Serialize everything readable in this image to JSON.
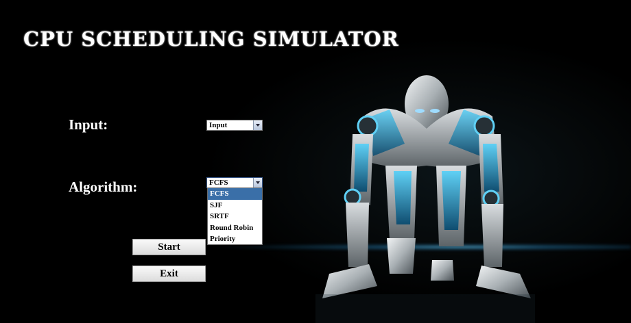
{
  "app": {
    "title": "CPU SCHEDULING SIMULATOR"
  },
  "input": {
    "label": "Input:",
    "selected": "Input"
  },
  "algorithm": {
    "label": "Algorithm:",
    "selected": "FCFS",
    "options": [
      "FCFS",
      "SJF",
      "SRTF",
      "Round Robin",
      "Priority"
    ],
    "highlighted_index": 0
  },
  "buttons": {
    "start": "Start",
    "exit": "Exit"
  },
  "colors": {
    "background": "#000000",
    "text": "#ffffff",
    "dropdown_highlight": "#3a6fa8",
    "robot_accent": "#2aa8d8"
  },
  "background_image": {
    "icon": "robot-runner-image"
  }
}
